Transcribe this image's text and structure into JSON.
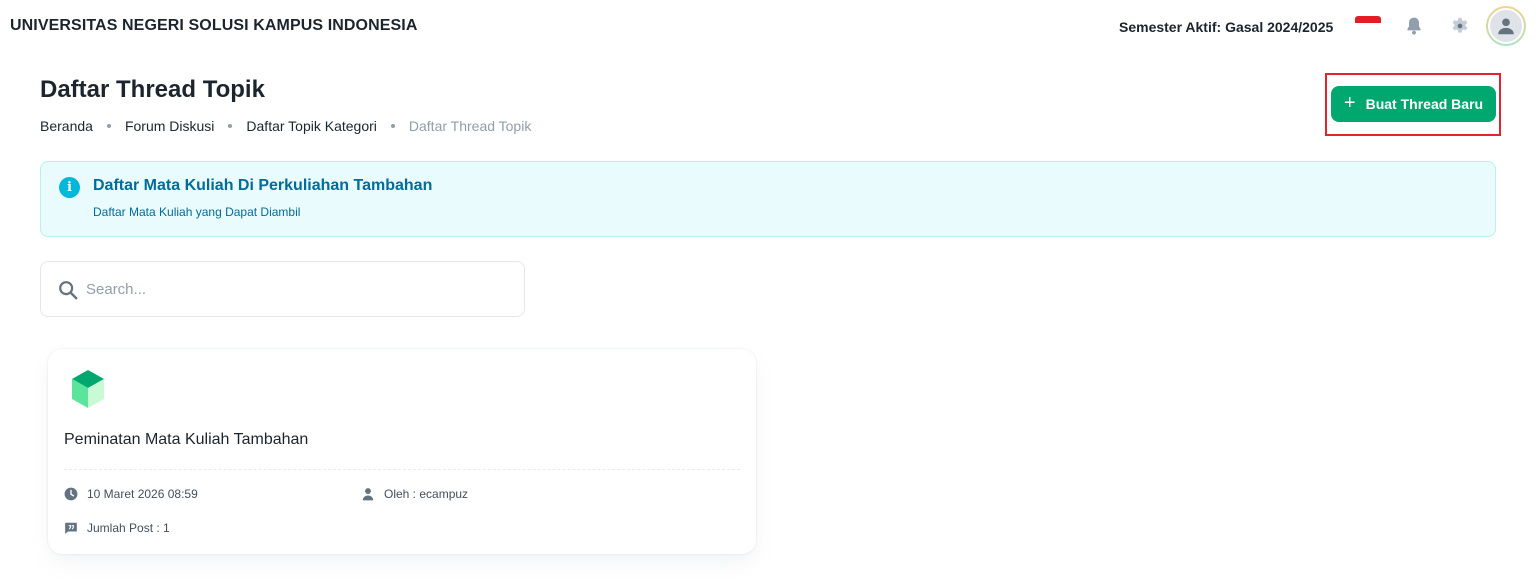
{
  "header": {
    "university": "UNIVERSITAS NEGERI SOLUSI KAMPUS INDONESIA",
    "semester": "Semester Aktif: Gasal 2024/2025",
    "icons": [
      "flag-id-icon",
      "bell-icon",
      "gear-icon",
      "user-avatar-icon"
    ]
  },
  "page": {
    "title": "Daftar Thread Topik",
    "breadcrumb": [
      "Beranda",
      "Forum Diskusi",
      "Daftar Topik Kategori",
      "Daftar Thread Topik"
    ],
    "create_button": "Buat Thread Baru"
  },
  "alert": {
    "title": "Daftar Mata Kuliah Di Perkuliahan Tambahan",
    "subtitle": "Daftar Mata Kuliah yang Dapat Diambil",
    "icon": "i"
  },
  "search": {
    "placeholder": "Search...",
    "value": ""
  },
  "threads": [
    {
      "title": "Peminatan Mata Kuliah Tambahan",
      "date": "10 Maret 2026 08:59",
      "author": "Oleh : ecampuz",
      "posts": "Jumlah Post : 1"
    }
  ],
  "colors": {
    "primary": "#00a76f",
    "info": "#00b8d9",
    "info_bg": "#e9fbfd",
    "highlight": "#e0262b"
  }
}
